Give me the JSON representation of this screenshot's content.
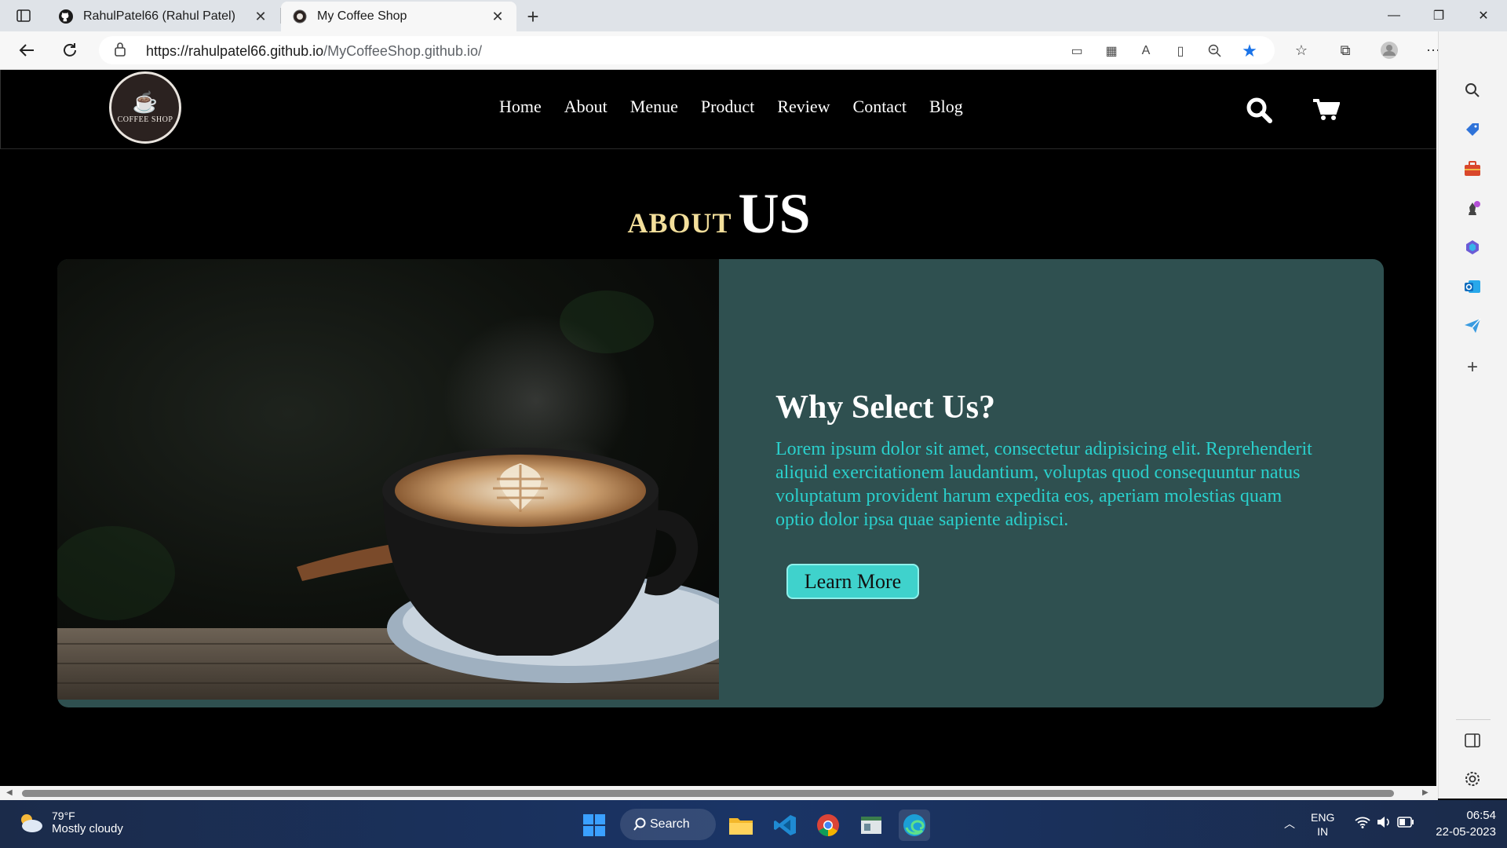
{
  "browser": {
    "tabs": [
      {
        "title": "RahulPatel66 (Rahul Patel)",
        "active": false
      },
      {
        "title": "My Coffee Shop",
        "active": true
      }
    ],
    "url_domain": "https://rahulpatel66.github.io",
    "url_path": "/MyCoffeeShop.github.io/",
    "accent": "#1a73e8"
  },
  "site": {
    "logo_text": "COFFEE SHOP",
    "nav": [
      "Home",
      "About",
      "Menue",
      "Product",
      "Review",
      "Contact",
      "Blog"
    ],
    "colors": {
      "bg": "#000000",
      "card": "#2f5050",
      "accent": "#2ad0cc",
      "heading_gold": "#f3df9b"
    }
  },
  "about": {
    "heading_part1": "about",
    "heading_part2": "US",
    "title": "Why Select Us?",
    "description": "Lorem ipsum dolor sit amet, consectetur adipisicing elit. Reprehenderit aliquid exercitationem laudantium, voluptas quod consequuntur natus voluptatum provident harum expedita eos, aperiam molestias quam optio dolor ipsa quae sapiente adipisci.",
    "button": "Learn More"
  },
  "taskbar": {
    "weather_temp": "79°F",
    "weather_cond": "Mostly cloudy",
    "search_label": "Search",
    "lang_top": "ENG",
    "lang_bottom": "IN",
    "time": "06:54",
    "date": "22-05-2023"
  }
}
